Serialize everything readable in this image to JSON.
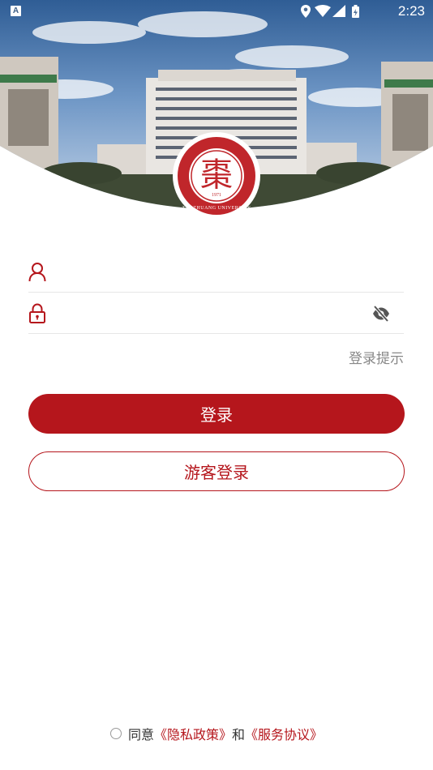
{
  "status_bar": {
    "time": "2:23",
    "notification_icon": "a-icon",
    "icons": [
      "location-icon",
      "wifi-icon",
      "signal-icon",
      "battery-icon"
    ]
  },
  "logo": {
    "mark": "棗",
    "arc_text": "ZAOZHUANG UNIVERSITY",
    "year": "1971"
  },
  "form": {
    "username_icon": "user-icon",
    "password_icon": "lock-icon",
    "visibility_icon": "eye-off-icon",
    "login_hint": "登录提示"
  },
  "buttons": {
    "login": "登录",
    "guest_login": "游客登录"
  },
  "agreement": {
    "prefix": "同意",
    "privacy_policy": "《隐私政策》",
    "conjunction": "和",
    "service_agreement": "《服务协议》"
  },
  "colors": {
    "accent": "#b5161c",
    "hint_text": "#888888",
    "divider": "#e6e6e6"
  }
}
